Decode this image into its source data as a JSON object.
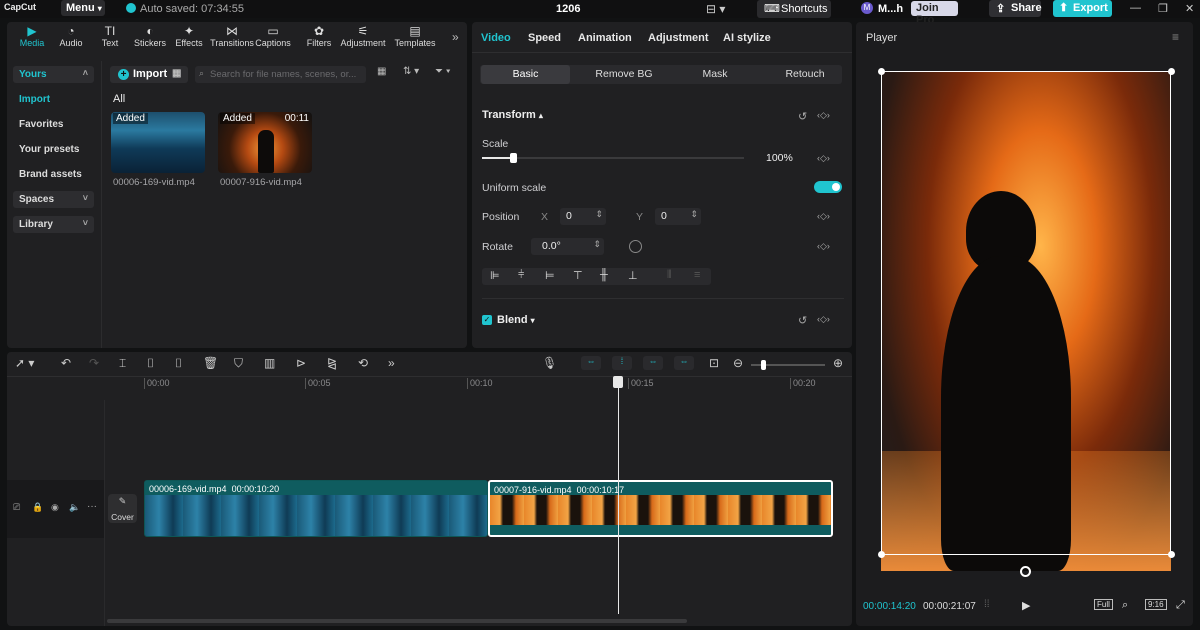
{
  "titlebar": {
    "logo": "CapCut",
    "menu": "Menu",
    "autosave": "Auto saved: 07:34:55",
    "project": "1206",
    "shortcuts": "Shortcuts",
    "user": "M...h",
    "user_initial": "M",
    "join_pro": "Join Pro",
    "share": "Share",
    "export": "Export"
  },
  "media_tabs": [
    {
      "label": "Media",
      "icon": "media-icon"
    },
    {
      "label": "Audio",
      "icon": "audio-icon"
    },
    {
      "label": "Text",
      "icon": "text-icon"
    },
    {
      "label": "Stickers",
      "icon": "sticker-icon"
    },
    {
      "label": "Effects",
      "icon": "effects-icon"
    },
    {
      "label": "Transitions",
      "icon": "transitions-icon"
    },
    {
      "label": "Captions",
      "icon": "captions-icon"
    },
    {
      "label": "Filters",
      "icon": "filters-icon"
    },
    {
      "label": "Adjustment",
      "icon": "adjustment-icon"
    },
    {
      "label": "Templates",
      "icon": "templates-icon"
    }
  ],
  "sidebar": {
    "yours": "Yours",
    "import": "Import",
    "favorites": "Favorites",
    "presets": "Your presets",
    "brand": "Brand assets",
    "spaces": "Spaces",
    "library": "Library"
  },
  "media": {
    "import_label": "Import",
    "search_placeholder": "Search for file names, scenes, or...",
    "section": "All",
    "items": [
      {
        "badge": "Added",
        "duration": "",
        "name": "00006-169-vid.mp4"
      },
      {
        "badge": "Added",
        "duration": "00:11",
        "name": "00007-916-vid.mp4"
      }
    ]
  },
  "props": {
    "tabs": [
      "Video",
      "Speed",
      "Animation",
      "Adjustment",
      "AI stylize"
    ],
    "subtabs": [
      "Basic",
      "Remove BG",
      "Mask",
      "Retouch"
    ],
    "transform": "Transform",
    "scale_label": "Scale",
    "scale_value": "100%",
    "scale_level": 0.12,
    "uniform": "Uniform scale",
    "uniform_on": true,
    "position_label": "Position",
    "x_label": "X",
    "x_value": "0",
    "y_label": "Y",
    "y_value": "0",
    "rotate_label": "Rotate",
    "rotate_value": "0.0°",
    "blend": "Blend"
  },
  "timeline": {
    "ticks": [
      "00:00",
      "00:05",
      "00:10",
      "00:15",
      "00:20"
    ],
    "cover": "Cover",
    "clips": [
      {
        "name": "00006-169-vid.mp4",
        "duration": "00:00:10:20"
      },
      {
        "name": "00007-916-vid.mp4",
        "duration": "00:00:10:17"
      }
    ]
  },
  "player": {
    "title": "Player",
    "current": "00:00:14:20",
    "total": "00:00:21:07",
    "full": "Full",
    "ratio": "9:16"
  },
  "colors": {
    "accent": "#20c4cf",
    "panel": "#202022"
  }
}
